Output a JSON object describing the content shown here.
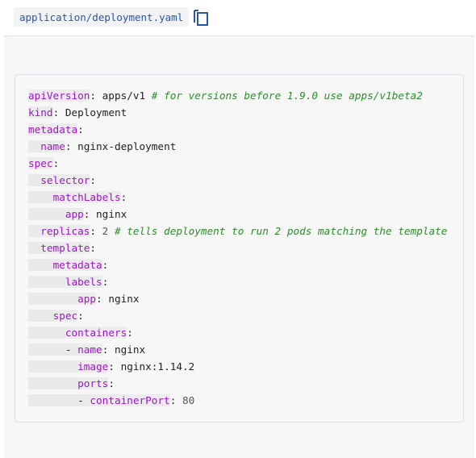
{
  "header": {
    "file_path": "application/deployment.yaml",
    "copy_icon": "copy-icon"
  },
  "colors": {
    "key": "#9b16c6",
    "comment": "#2e8b2e",
    "file_path": "#2a55a7",
    "panel_bg": "#f5f6f7"
  },
  "code": {
    "language": "yaml",
    "lines": [
      {
        "indent": "",
        "dash": "",
        "key": "apiVersion",
        "value": "apps/v1",
        "vtype": "str",
        "comment": "# for versions before 1.9.0 use apps/v1beta2"
      },
      {
        "indent": "",
        "dash": "",
        "key": "kind",
        "value": "Deployment",
        "vtype": "str",
        "comment": ""
      },
      {
        "indent": "",
        "dash": "",
        "key": "metadata",
        "value": "",
        "vtype": "str",
        "comment": ""
      },
      {
        "indent": "  ",
        "dash": "",
        "key": "name",
        "value": "nginx-deployment",
        "vtype": "str",
        "comment": ""
      },
      {
        "indent": "",
        "dash": "",
        "key": "spec",
        "value": "",
        "vtype": "str",
        "comment": ""
      },
      {
        "indent": "  ",
        "dash": "",
        "key": "selector",
        "value": "",
        "vtype": "str",
        "comment": ""
      },
      {
        "indent": "    ",
        "dash": "",
        "key": "matchLabels",
        "value": "",
        "vtype": "str",
        "comment": ""
      },
      {
        "indent": "      ",
        "dash": "",
        "key": "app",
        "value": "nginx",
        "vtype": "str",
        "comment": ""
      },
      {
        "indent": "  ",
        "dash": "",
        "key": "replicas",
        "value": "2",
        "vtype": "num",
        "comment": "# tells deployment to run 2 pods matching the template"
      },
      {
        "indent": "  ",
        "dash": "",
        "key": "template",
        "value": "",
        "vtype": "str",
        "comment": ""
      },
      {
        "indent": "    ",
        "dash": "",
        "key": "metadata",
        "value": "",
        "vtype": "str",
        "comment": ""
      },
      {
        "indent": "      ",
        "dash": "",
        "key": "labels",
        "value": "",
        "vtype": "str",
        "comment": ""
      },
      {
        "indent": "        ",
        "dash": "",
        "key": "app",
        "value": "nginx",
        "vtype": "str",
        "comment": ""
      },
      {
        "indent": "    ",
        "dash": "",
        "key": "spec",
        "value": "",
        "vtype": "str",
        "comment": ""
      },
      {
        "indent": "      ",
        "dash": "",
        "key": "containers",
        "value": "",
        "vtype": "str",
        "comment": ""
      },
      {
        "indent": "      ",
        "dash": "- ",
        "key": "name",
        "value": "nginx",
        "vtype": "str",
        "comment": ""
      },
      {
        "indent": "        ",
        "dash": "",
        "key": "image",
        "value": "nginx:1.14.2",
        "vtype": "str",
        "comment": ""
      },
      {
        "indent": "        ",
        "dash": "",
        "key": "ports",
        "value": "",
        "vtype": "str",
        "comment": ""
      },
      {
        "indent": "        ",
        "dash": "- ",
        "key": "containerPort",
        "value": "80",
        "vtype": "num",
        "comment": ""
      }
    ]
  }
}
